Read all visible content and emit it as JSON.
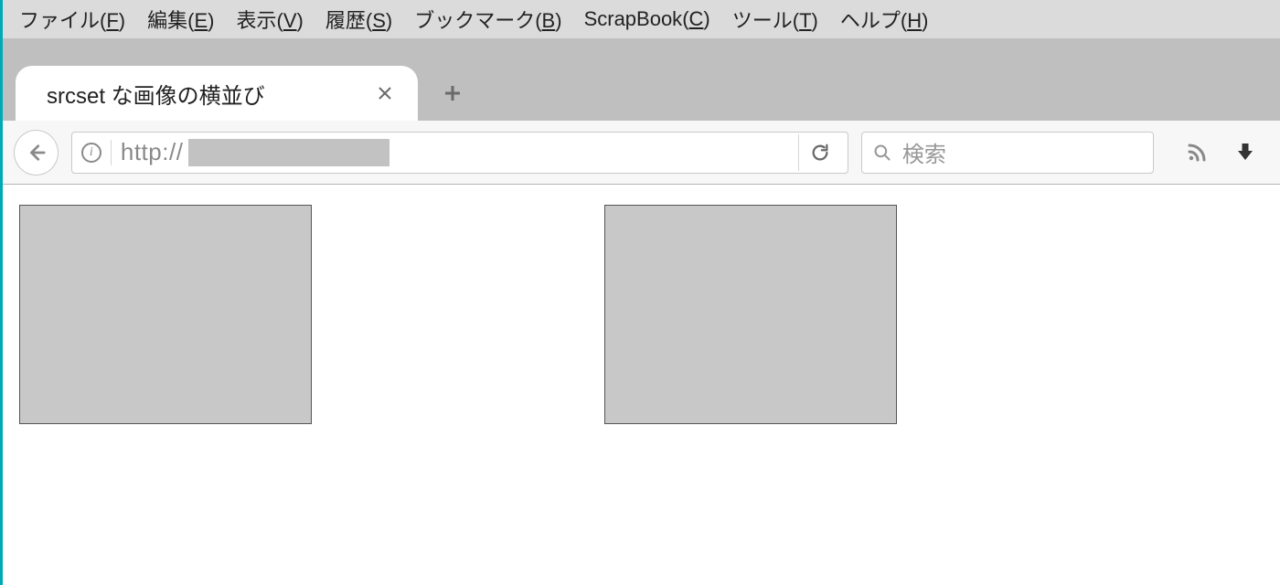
{
  "menu": {
    "items": [
      {
        "label": "ファイル",
        "key": "F"
      },
      {
        "label": "編集",
        "key": "E"
      },
      {
        "label": "表示",
        "key": "V"
      },
      {
        "label": "履歴",
        "key": "S"
      },
      {
        "label": "ブックマーク",
        "key": "B"
      },
      {
        "label": "ScrapBook",
        "key": "C"
      },
      {
        "label": "ツール",
        "key": "T"
      },
      {
        "label": "ヘルプ",
        "key": "H"
      }
    ]
  },
  "tab": {
    "title": "srcset な画像の横並び"
  },
  "urlbar": {
    "scheme": "http://"
  },
  "search": {
    "placeholder": "検索"
  }
}
